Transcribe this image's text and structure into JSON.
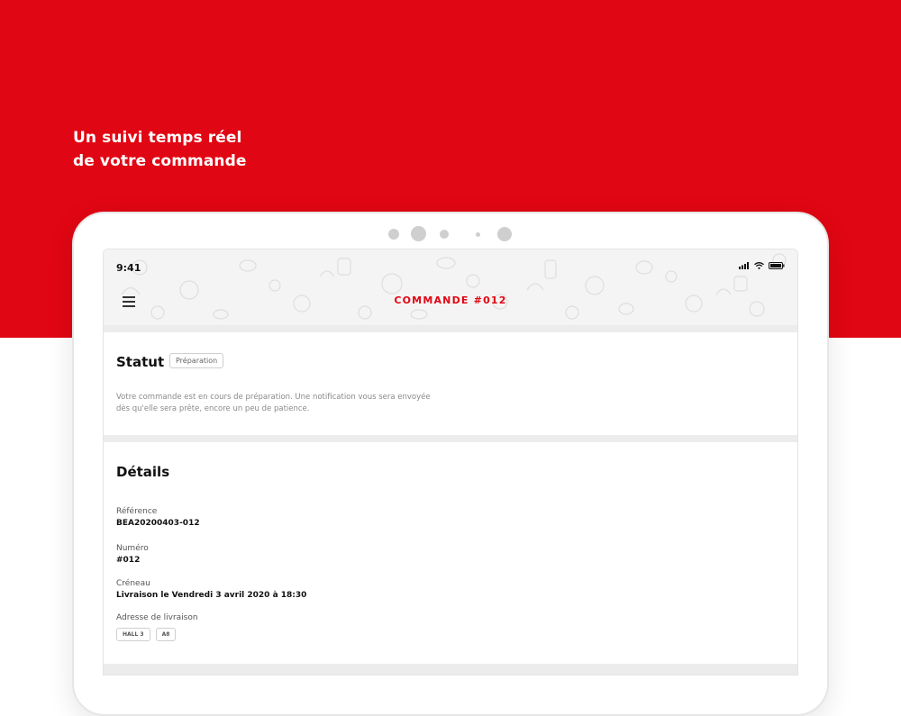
{
  "hero": {
    "line1": "Un suivi temps réel",
    "line2": "de votre commande"
  },
  "device": {
    "time": "9:41"
  },
  "appbar": {
    "title": "COMMANDE #012"
  },
  "status": {
    "title": "Statut",
    "badge": "Préparation",
    "line1": "Votre commande est en cours de préparation. Une notification vous sera envoyée",
    "line2": "dès qu'elle sera prête, encore un peu de patience."
  },
  "details": {
    "title": "Détails",
    "reference_label": "Référence",
    "reference_value": "BEA20200403-012",
    "number_label": "Numéro",
    "number_value": "#012",
    "slot_label": "Créneau",
    "slot_value": "Livraison le Vendredi 3 avril 2020 à 18:30",
    "address_label": "Adresse de livraison",
    "tags": [
      "HALL 3",
      "A8"
    ]
  },
  "colors": {
    "brand_red": "#e10613"
  },
  "icons": {
    "menu": "hamburger-menu-icon",
    "signal": "signal-icon",
    "wifi": "wifi-icon",
    "battery": "battery-icon"
  }
}
